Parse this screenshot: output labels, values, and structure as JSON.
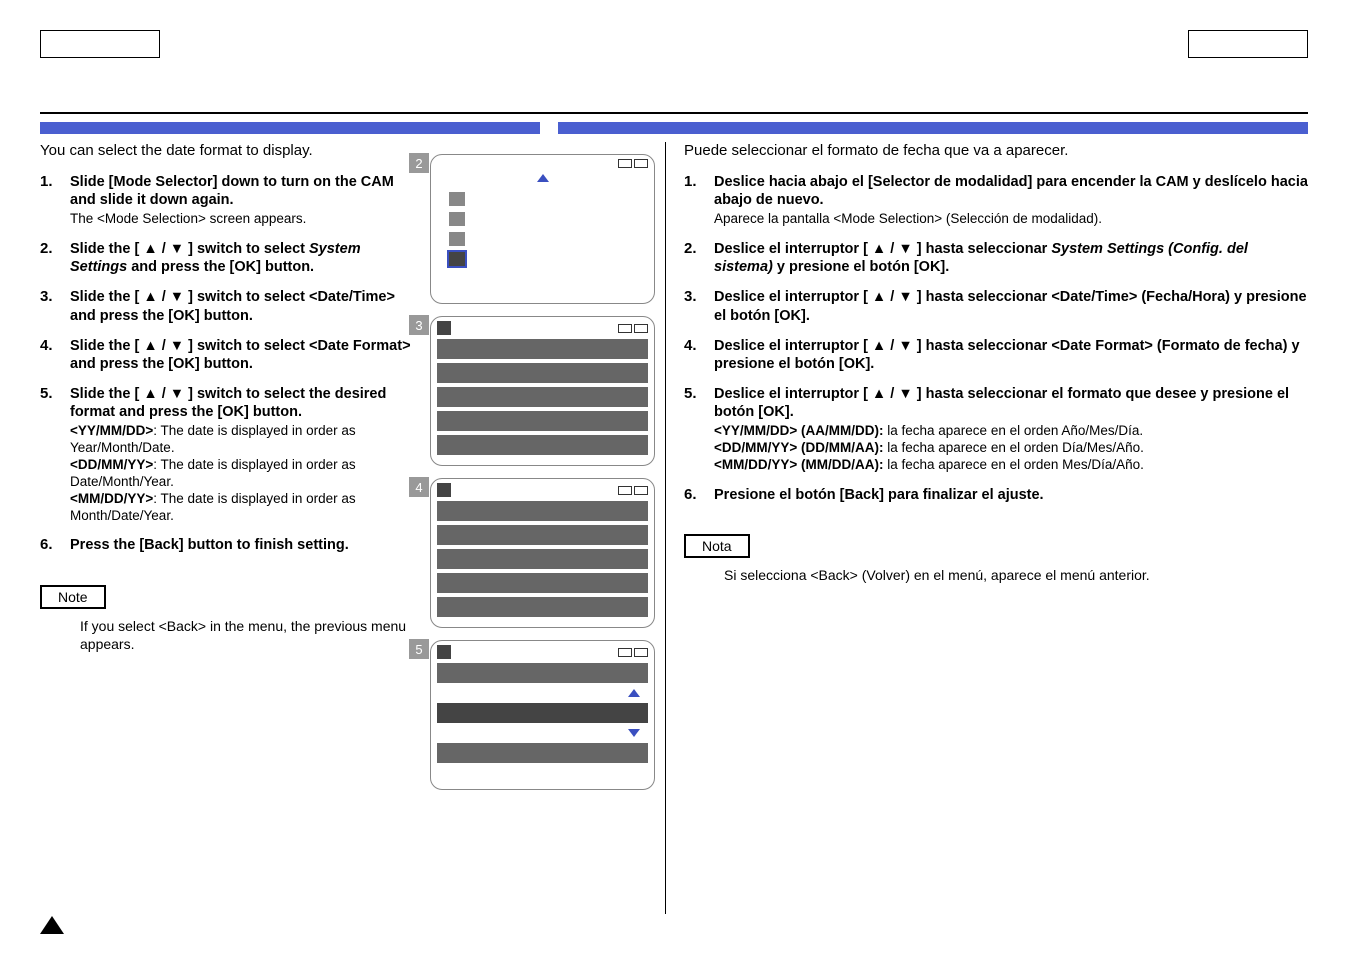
{
  "left": {
    "intro": "You can select the date format to display.",
    "steps": [
      {
        "n": "1.",
        "main": "Slide [Mode Selector] down to turn on the CAM and slide it down again.",
        "sub": "The <Mode Selection> screen appears."
      },
      {
        "n": "2.",
        "main_html": "Slide the [ ▲ / ▼ ] switch to select <em>System Settings</em> and press the [OK] button."
      },
      {
        "n": "3.",
        "main": "Slide the [ ▲ / ▼ ] switch to select <Date/Time> and press the [OK] button."
      },
      {
        "n": "4.",
        "main": "Slide the [ ▲ / ▼ ] switch to select <Date Format> and press the [OK] button."
      },
      {
        "n": "5.",
        "main": "Slide the [ ▲ / ▼ ] switch to select the desired format and press the [OK] button.",
        "sub_html": "<b>&lt;YY/MM/DD&gt;</b>: The date is displayed in order as Year/Month/Date.<br><b>&lt;DD/MM/YY&gt;</b>: The date is displayed in order as Date/Month/Year.<br><b>&lt;MM/DD/YY&gt;</b>: The date is displayed in order as Month/Date/Year."
      },
      {
        "n": "6.",
        "main": "Press the [Back] button to finish setting."
      }
    ],
    "note_label": "Note",
    "note_text": "If you select <Back> in the menu, the previous menu appears."
  },
  "right": {
    "intro": "Puede seleccionar el formato de fecha que va a aparecer.",
    "steps": [
      {
        "n": "1.",
        "main": "Deslice hacia abajo el [Selector de modalidad] para encender la CAM y deslícelo hacia abajo de nuevo.",
        "sub": "Aparece la pantalla <Mode Selection> (Selección de modalidad)."
      },
      {
        "n": "2.",
        "main_html": "Deslice el interruptor [ ▲ / ▼ ] hasta seleccionar <em>System Settings (Config. del sistema)</em> y presione el botón [OK]."
      },
      {
        "n": "3.",
        "main": "Deslice el interruptor [ ▲ / ▼ ] hasta seleccionar <Date/Time> (Fecha/Hora) y presione el botón [OK]."
      },
      {
        "n": "4.",
        "main": "Deslice el interruptor [ ▲ / ▼ ] hasta seleccionar <Date Format> (Formato de fecha) y presione el botón [OK]."
      },
      {
        "n": "5.",
        "main": "Deslice el interruptor [ ▲ / ▼ ] hasta seleccionar el formato que desee y presione el botón [OK].",
        "sub_html": "<b>&lt;YY/MM/DD&gt; (AA/MM/DD):</b> la fecha aparece en el orden Año/Mes/Día.<br><b>&lt;DD/MM/YY&gt; (DD/MM/AA):</b> la fecha aparece en el orden Día/Mes/Año.<br><b>&lt;MM/DD/YY&gt; (MM/DD/AA):</b> la fecha aparece en el orden Mes/Día/Año."
      },
      {
        "n": "6.",
        "main": "Presione el botón [Back] para finalizar el ajuste."
      }
    ],
    "note_label": "Nota",
    "note_text": "Si selecciona <Back> (Volver) en el menú, aparece el menú anterior."
  },
  "shots": [
    "2",
    "3",
    "4",
    "5"
  ]
}
